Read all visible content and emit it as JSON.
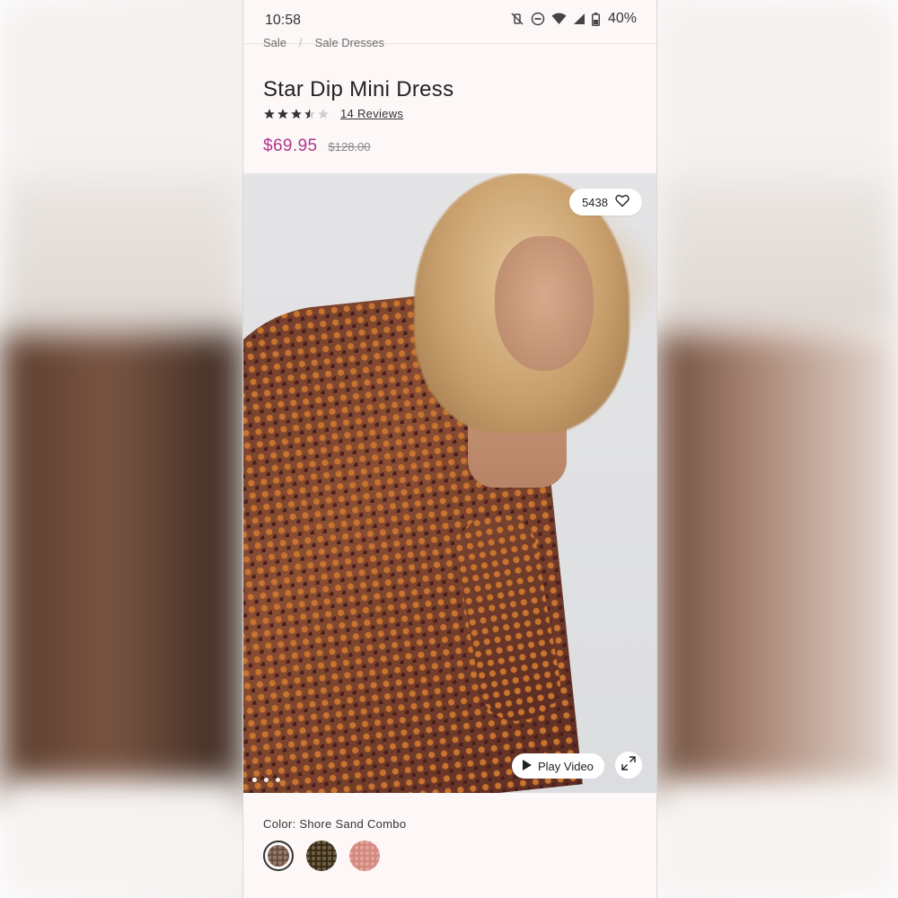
{
  "status_bar": {
    "time": "10:58",
    "battery": "40%"
  },
  "breadcrumb": [
    "Sale",
    "Sale Dresses"
  ],
  "product": {
    "title": "Star Dip Mini Dress",
    "rating": 3.5,
    "rating_max": 5,
    "reviews_label": "14 Reviews",
    "sale_price": "$69.95",
    "original_price": "$128.00"
  },
  "gallery": {
    "wishlist_count": "5438",
    "play_video_label": "Play Video",
    "image_count": 3,
    "active_image": 1
  },
  "color": {
    "label": "Color: Shore Sand Combo",
    "swatches": [
      {
        "name": "Shore Sand Combo",
        "color": "#6b4d3c",
        "selected": true
      },
      {
        "name": "Dark Combo",
        "color": "#3a2a10",
        "selected": false
      },
      {
        "name": "Pink Combo",
        "color": "#d4857a",
        "selected": false
      }
    ]
  },
  "colors": {
    "accent_price": "#b0368e",
    "background": "#fdf8f7"
  }
}
